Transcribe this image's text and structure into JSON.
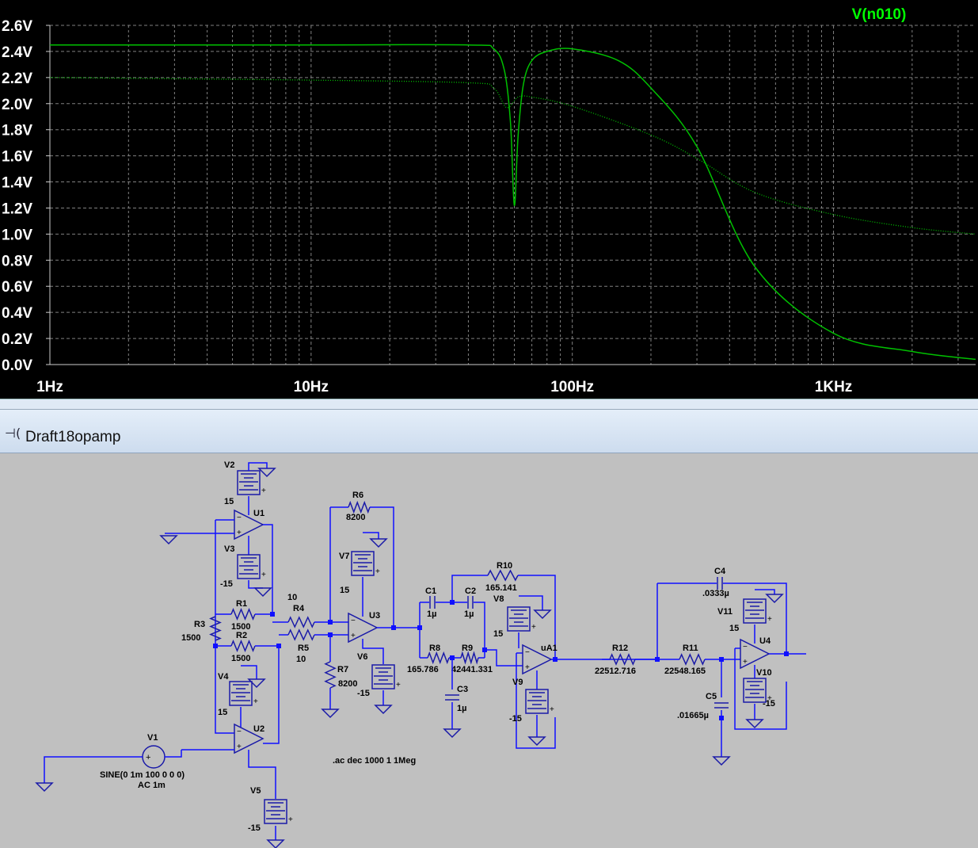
{
  "plot": {
    "trace_label": "V(n010)",
    "y_ticks": [
      "2.6V",
      "2.4V",
      "2.2V",
      "2.0V",
      "1.8V",
      "1.6V",
      "1.4V",
      "1.2V",
      "1.0V",
      "0.8V",
      "0.6V",
      "0.4V",
      "0.2V",
      "0.0V"
    ],
    "x_ticks": [
      "1Hz",
      "10Hz",
      "100Hz",
      "1KHz"
    ],
    "colors": {
      "background": "#000000",
      "grid": "#808080",
      "trace": "#00c000",
      "label": "#00ff00",
      "axis_text": "#ffffff"
    }
  },
  "chart_data": {
    "type": "line",
    "title": "",
    "xlabel": "",
    "ylabel": "",
    "x_scale": "log",
    "xlim": [
      1,
      3500
    ],
    "ylim": [
      0,
      2.6
    ],
    "series": [
      {
        "name": "V(n010)",
        "style": "solid",
        "x": [
          1,
          10,
          40,
          50,
          55,
          58,
          60,
          62,
          65,
          70,
          80,
          100,
          150,
          200,
          300,
          500,
          1000,
          2000,
          3500
        ],
        "y": [
          2.45,
          2.45,
          2.45,
          2.42,
          2.25,
          1.85,
          1.22,
          1.75,
          2.15,
          2.33,
          2.4,
          2.42,
          2.33,
          2.12,
          1.67,
          0.75,
          0.24,
          0.1,
          0.04
        ]
      },
      {
        "name": "",
        "style": "dotted",
        "x": [
          1,
          10,
          40,
          50,
          56,
          62,
          70,
          100,
          200,
          300,
          500,
          1000,
          2000,
          3500
        ],
        "y": [
          2.2,
          2.18,
          2.16,
          2.12,
          1.97,
          2.05,
          2.05,
          1.98,
          1.76,
          1.58,
          1.32,
          1.15,
          1.05,
          1.0
        ]
      }
    ]
  },
  "window": {
    "icon": "schematic-icon",
    "title": "Draft18opamp"
  },
  "schematic": {
    "directive": ".ac dec 1000 1 1Meg",
    "labels": {
      "V2": "V2",
      "V2v": "15",
      "U1": "U1",
      "V3": "V3",
      "V3v": "-15",
      "R1": "R1",
      "R1v": "1500",
      "R2": "R2",
      "R2v": "1500",
      "R3": "R3",
      "R3v": "1500",
      "V4": "V4",
      "V4v": "15",
      "U2": "U2",
      "V1": "V1",
      "V1src": "SINE(0 1m 100 0 0 0)",
      "V1ac": "AC 1m",
      "V5": "V5",
      "V5v": "-15",
      "R4v": "10",
      "R4": "R4",
      "R5": "R5",
      "R5v": "10",
      "R6": "R6",
      "R6v": "8200",
      "V7": "V7",
      "V7v": "15",
      "U3": "U3",
      "V6": "V6",
      "V6v": "-15",
      "R7": "R7",
      "R7v": "8200",
      "C1": "C1",
      "C1v": "1µ",
      "C2": "C2",
      "C2v": "1µ",
      "R10": "R10",
      "R10v": "165.141",
      "V8": "V8",
      "V8v": "15",
      "R8": "R8",
      "R8v": "165.786",
      "R9": "R9",
      "R9v": "42441.331",
      "C3": "C3",
      "C3v": "1µ",
      "uA1": "uA1",
      "V9": "V9",
      "V9v": "-15",
      "R12": "R12",
      "R12v": "22512.716",
      "R11": "R11",
      "R11v": "22548.165",
      "C4": "C4",
      "C4v": ".0333µ",
      "V11": "V11",
      "V11v": "15",
      "U4": "U4",
      "V10": "V10",
      "V10v": "-15",
      "C5": "C5",
      "C5v": ".01665µ"
    }
  }
}
